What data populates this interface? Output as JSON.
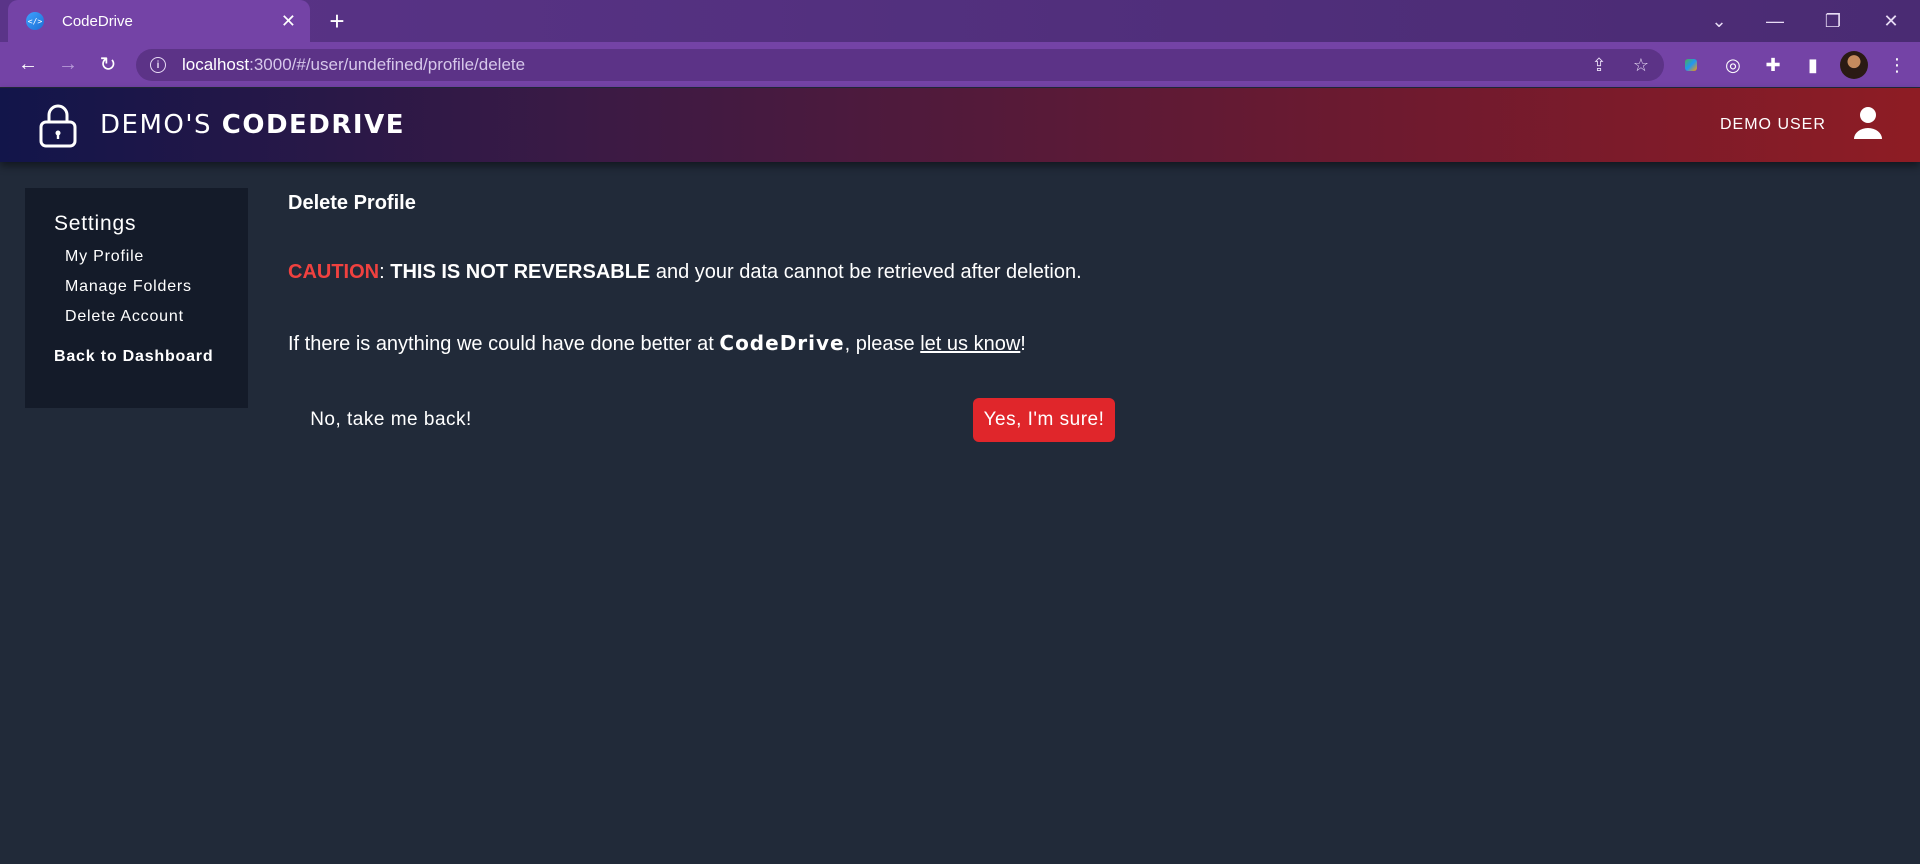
{
  "browser": {
    "tab_title": "CodeDrive",
    "tab_favicon_text": "</>",
    "url_host": "localhost",
    "url_rest": ":3000/#/user/undefined/profile/delete"
  },
  "header": {
    "brand_prefix": "DEMO'S ",
    "brand_name": "CODEDRIVE",
    "user_name": "DEMO USER"
  },
  "sidebar": {
    "title": "Settings",
    "items": [
      {
        "label": "My Profile"
      },
      {
        "label": "Manage Folders"
      },
      {
        "label": "Delete Account"
      }
    ],
    "back_label": "Back to Dashboard"
  },
  "main": {
    "title": "Delete Profile",
    "caution_word": "CAUTION",
    "caution_colon": ": ",
    "not_reversable": "THIS IS NOT REVERSABLE",
    "caution_rest": " and your data cannot be retrieved after deletion.",
    "feedback_prefix": "If there is anything we could have done better at ",
    "feedback_brand": "CodeDrive",
    "feedback_mid": ", please ",
    "feedback_link": "let us know",
    "feedback_end": "!",
    "cancel_label": "No, take me back!",
    "confirm_label": "Yes, I'm sure!"
  },
  "colors": {
    "caution": "#f0413f",
    "confirm_button": "#e0262b",
    "page_background": "#212a39",
    "sidebar_background": "#141b29",
    "browser_accent": "#7443a6"
  }
}
